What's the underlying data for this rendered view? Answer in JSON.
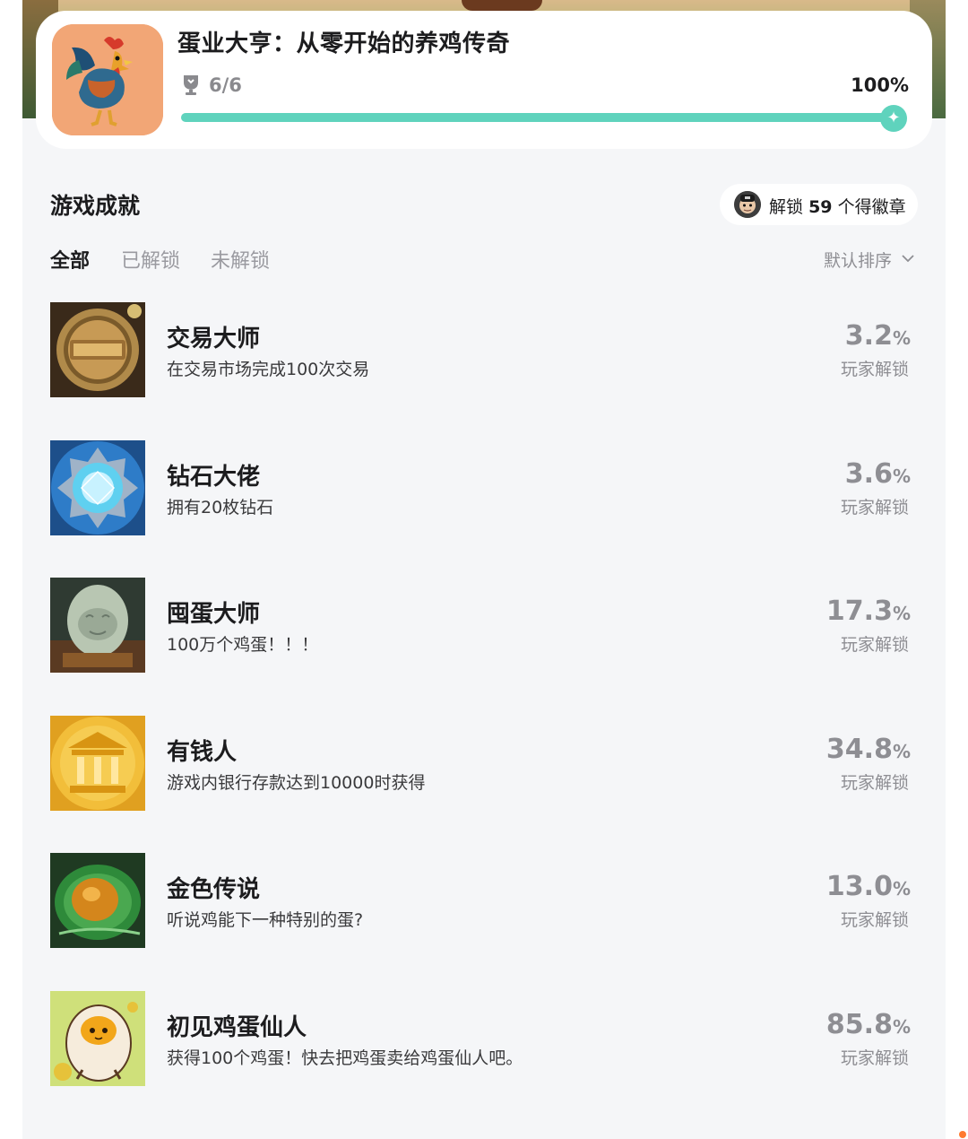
{
  "game": {
    "title": "蛋业大亨：从零开始的养鸡传奇",
    "progress_count": "6/6",
    "progress_percent": "100%",
    "progress_fraction": 1.0
  },
  "section": {
    "title": "游戏成就",
    "badge_prefix": "解锁",
    "badge_count": "59",
    "badge_suffix": "个得徽章"
  },
  "tabs": [
    {
      "label": "全部",
      "active": true
    },
    {
      "label": "已解锁",
      "active": false
    },
    {
      "label": "未解锁",
      "active": false
    }
  ],
  "sort": {
    "label": "默认排序"
  },
  "achievements": [
    {
      "name": "交易大师",
      "desc": "在交易市场完成100次交易",
      "rate": "3.2",
      "unit": "%",
      "rate_label": "玩家解锁"
    },
    {
      "name": "钻石大佬",
      "desc": "拥有20枚钻石",
      "rate": "3.6",
      "unit": "%",
      "rate_label": "玩家解锁"
    },
    {
      "name": "囤蛋大师",
      "desc": "100万个鸡蛋！！！",
      "rate": "17.3",
      "unit": "%",
      "rate_label": "玩家解锁"
    },
    {
      "name": "有钱人",
      "desc": "游戏内银行存款达到10000时获得",
      "rate": "34.8",
      "unit": "%",
      "rate_label": "玩家解锁"
    },
    {
      "name": "金色传说",
      "desc": "听说鸡能下一种特别的蛋?",
      "rate": "13.0",
      "unit": "%",
      "rate_label": "玩家解锁"
    },
    {
      "name": "初见鸡蛋仙人",
      "desc": "获得100个鸡蛋！快去把鸡蛋卖给鸡蛋仙人吧。",
      "rate": "85.8",
      "unit": "%",
      "rate_label": "玩家解锁"
    }
  ],
  "icons": {
    "trophy": "trophy-icon",
    "chevron": "chevron-down-icon",
    "knob": "sparkle-icon"
  },
  "colors": {
    "accent": "#5fd3bd",
    "background": "#f5f6f8"
  }
}
